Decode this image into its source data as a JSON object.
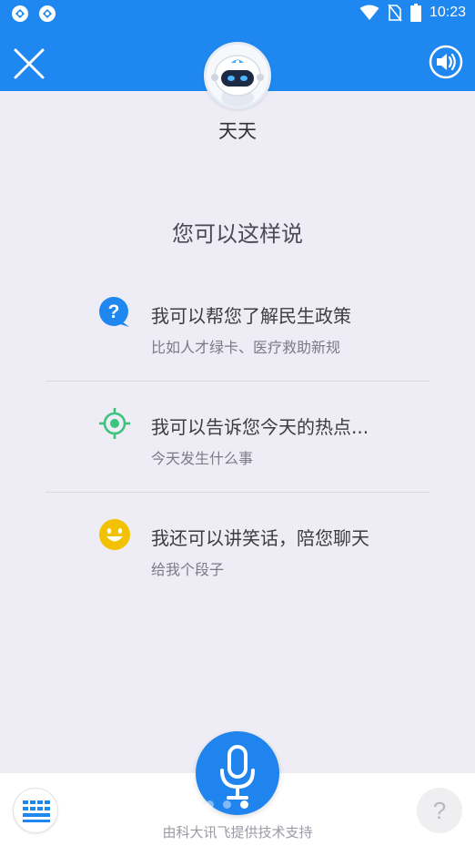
{
  "status_bar": {
    "left_icons": [
      "app-notification-icon",
      "app-notification-icon"
    ],
    "right_icons": [
      "wifi-icon",
      "no-sim-icon",
      "battery-icon"
    ],
    "time": "10:23"
  },
  "header": {
    "close_icon": "close-icon",
    "sound_icon": "speaker-icon",
    "accent_color": "#1e88f0"
  },
  "bot": {
    "avatar_icon": "robot-avatar",
    "name": "天天"
  },
  "prompt_title": "您可以这样说",
  "suggestions": [
    {
      "icon": "question-bubble-icon",
      "icon_color": "#1e88f0",
      "title": "我可以帮您了解民生政策",
      "subtitle": "比如人才绿卡、医疗救助新规"
    },
    {
      "icon": "target-icon",
      "icon_color": "#3cc47c",
      "title": "我可以告诉您今天的热点...",
      "subtitle": "今天发生什么事"
    },
    {
      "icon": "smiley-icon",
      "icon_color": "#f2c200",
      "title": "我还可以讲笑话，陪您聊天",
      "subtitle": "给我个段子"
    }
  ],
  "bottom": {
    "keyboard_icon": "keyboard-icon",
    "mic_icon": "microphone-icon",
    "help_label": "?",
    "powered_by": "由科大讯飞提供技术支持",
    "page_dots": 3,
    "active_dot": 3
  }
}
